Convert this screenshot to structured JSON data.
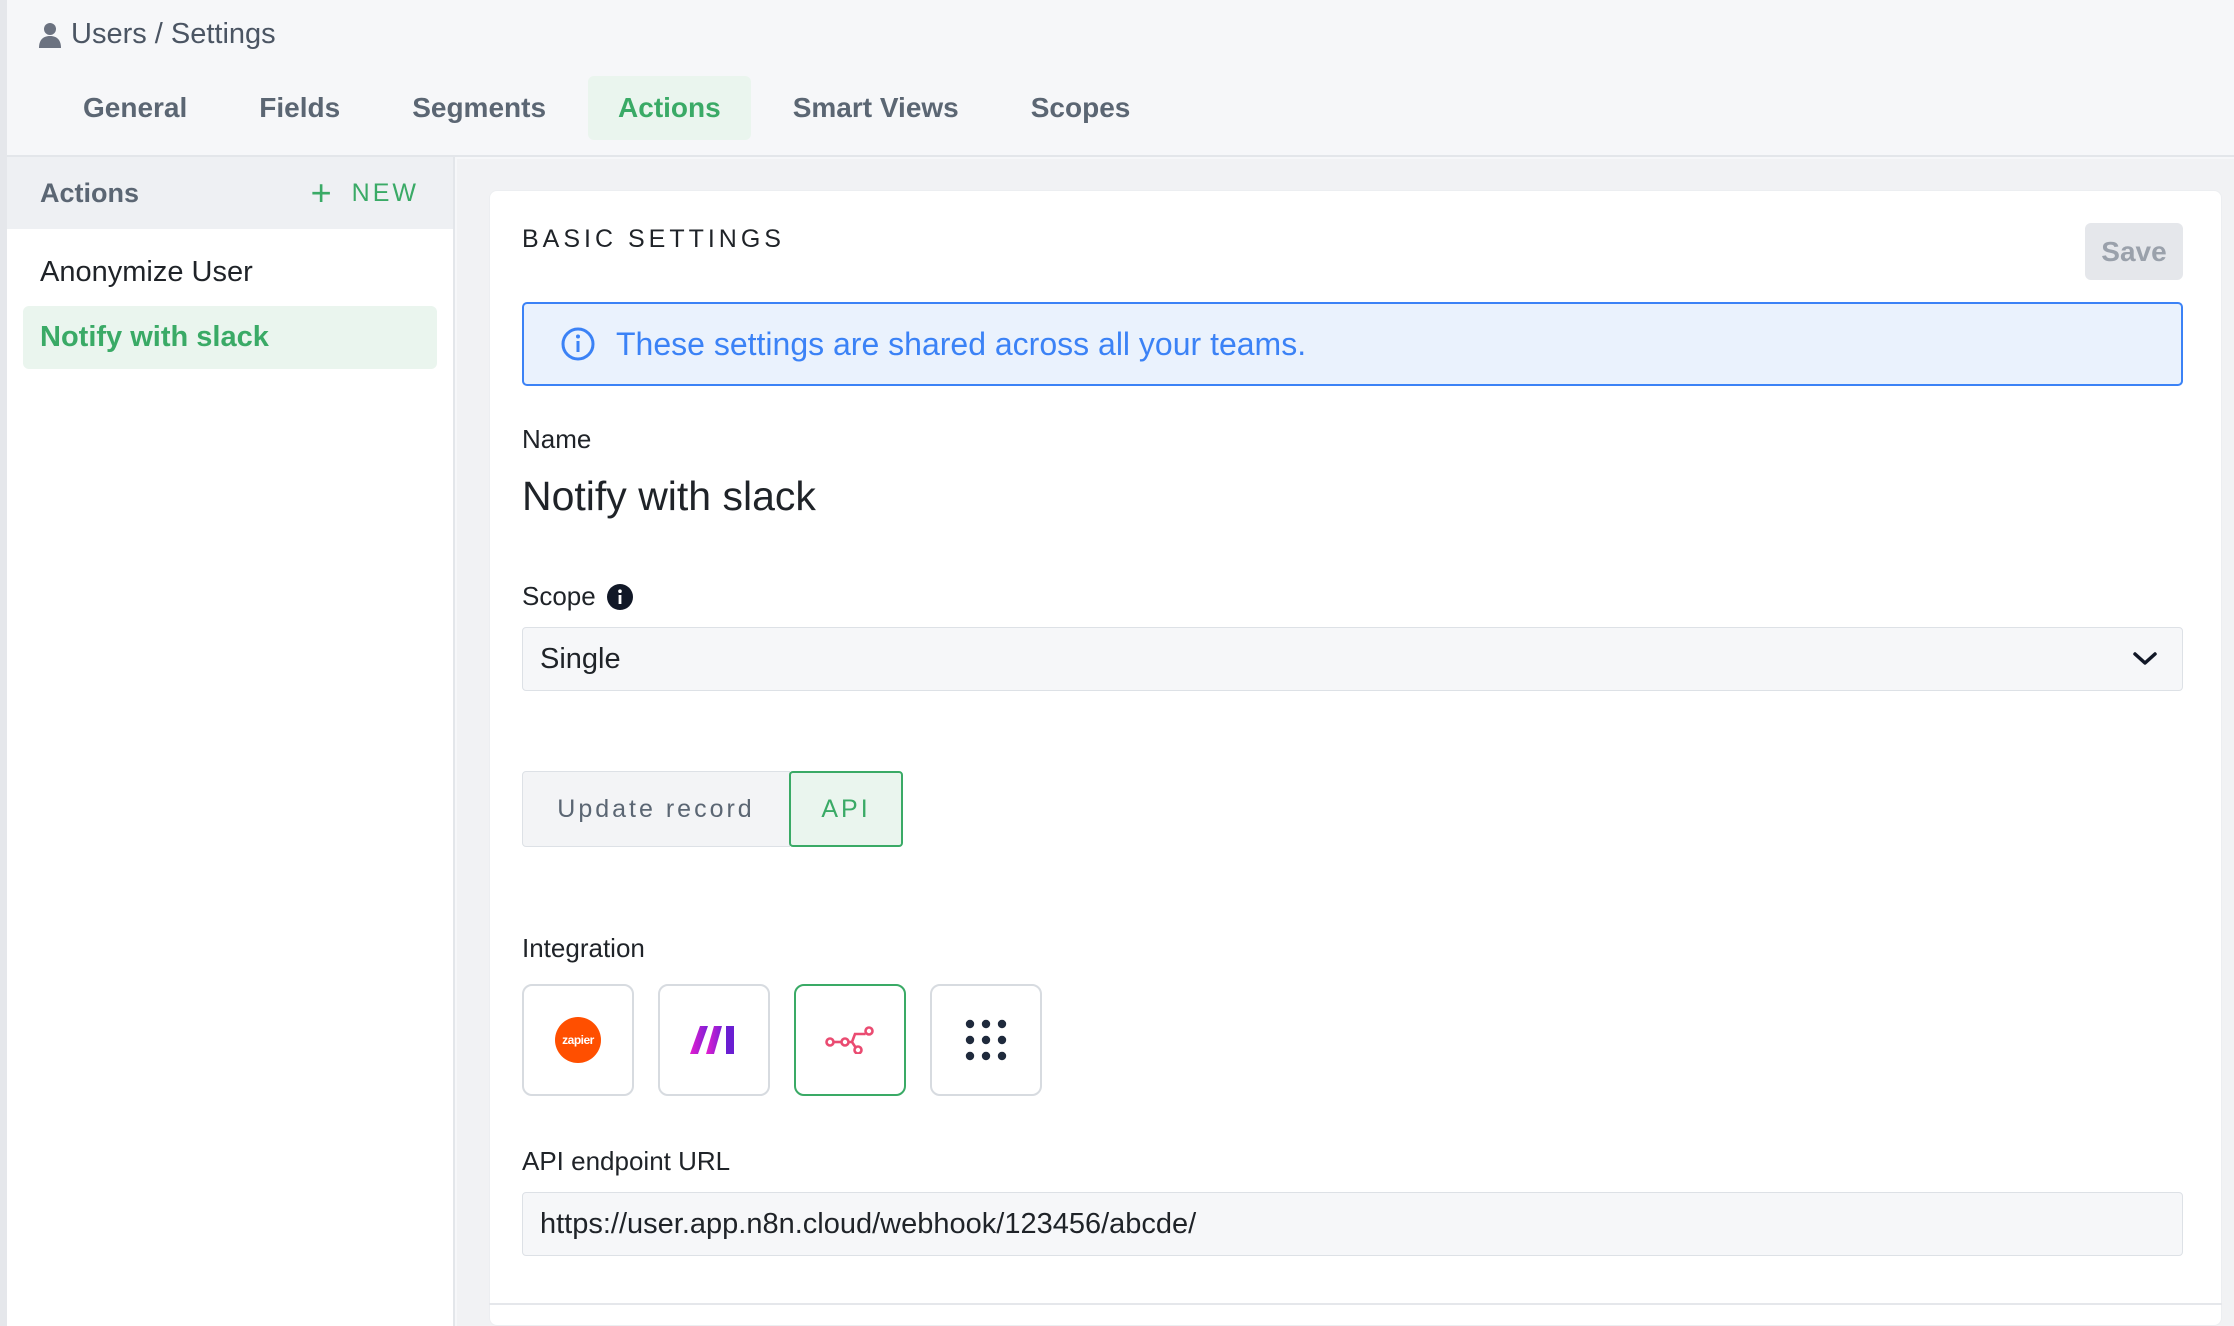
{
  "breadcrumb": {
    "icon": "user-icon",
    "text": "Users / Settings"
  },
  "tabs": [
    {
      "label": "General"
    },
    {
      "label": "Fields"
    },
    {
      "label": "Segments"
    },
    {
      "label": "Actions",
      "active": true
    },
    {
      "label": "Smart Views"
    },
    {
      "label": "Scopes"
    }
  ],
  "sidebar": {
    "title": "Actions",
    "new_label": "NEW",
    "items": [
      {
        "label": "Anonymize User"
      },
      {
        "label": "Notify with slack",
        "active": true
      }
    ]
  },
  "main": {
    "section_title": "BASIC SETTINGS",
    "save_label": "Save",
    "info_banner": "These settings are shared across all your teams.",
    "name_label": "Name",
    "name_value": "Notify with slack",
    "scope_label": "Scope",
    "scope_value": "Single",
    "action_types": [
      "Update record",
      "API"
    ],
    "action_type_selected": "API",
    "integration_label": "Integration",
    "integrations": [
      {
        "name": "zapier",
        "logo_text": "zapier"
      },
      {
        "name": "make"
      },
      {
        "name": "n8n",
        "selected": true
      },
      {
        "name": "more"
      }
    ],
    "endpoint_label": "API endpoint URL",
    "endpoint_value": "https://user.app.n8n.cloud/webhook/123456/abcde/"
  },
  "colors": {
    "accent": "#3aaa66",
    "info": "#3b82f6",
    "zapier": "#ff4f00",
    "make": "#b620e0",
    "n8n": "#ea4b71"
  }
}
